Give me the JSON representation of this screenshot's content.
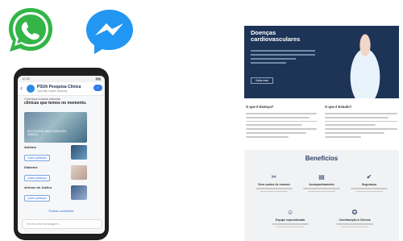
{
  "apps": {
    "whatsapp": {
      "icon": "whatsapp-icon",
      "color": "#33b548"
    },
    "messenger": {
      "icon": "messenger-icon",
      "color": "#2196f3"
    }
  },
  "phone": {
    "status": {
      "time": "10:30",
      "signal": "▮▮▮"
    },
    "header": {
      "title": "PSUh Pesquisa Clínica",
      "subtitle": "Typically replies instantly",
      "action_label": "✓"
    },
    "intro": {
      "line1": "Conheça nossos estudos",
      "headline": "clínicas que temos no momento."
    },
    "hero_caption": "SELECIONE UMA CONDIÇÃO ABAIXO",
    "items": [
      {
        "name": "Asthma",
        "button": "Quero participar"
      },
      {
        "name": "Diabetes",
        "button": "Quero participar"
      },
      {
        "name": "Artrose de Joelho",
        "button": "Quero participar"
      }
    ],
    "more_link": "Outras condições",
    "input_placeholder": "Envie uma mensagem..."
  },
  "site": {
    "hero": {
      "title_line1": "Doenças",
      "title_line2": "cardiovasculares",
      "cta": "Saiba mais"
    },
    "col_left_title": "O que é Doença?",
    "col_right_title": "O que é Estudo?",
    "benefits": {
      "title": "Benefícios",
      "items": [
        {
          "icon": "scissors-icon",
          "label": "Sem custos de exames"
        },
        {
          "icon": "document-icon",
          "label": "Acompanhamento"
        },
        {
          "icon": "clipboard-icon",
          "label": "Segurança"
        },
        {
          "icon": "doctor-icon",
          "label": "Equipe especializada"
        },
        {
          "icon": "award-icon",
          "label": "Contribuição à Ciência"
        }
      ]
    }
  }
}
